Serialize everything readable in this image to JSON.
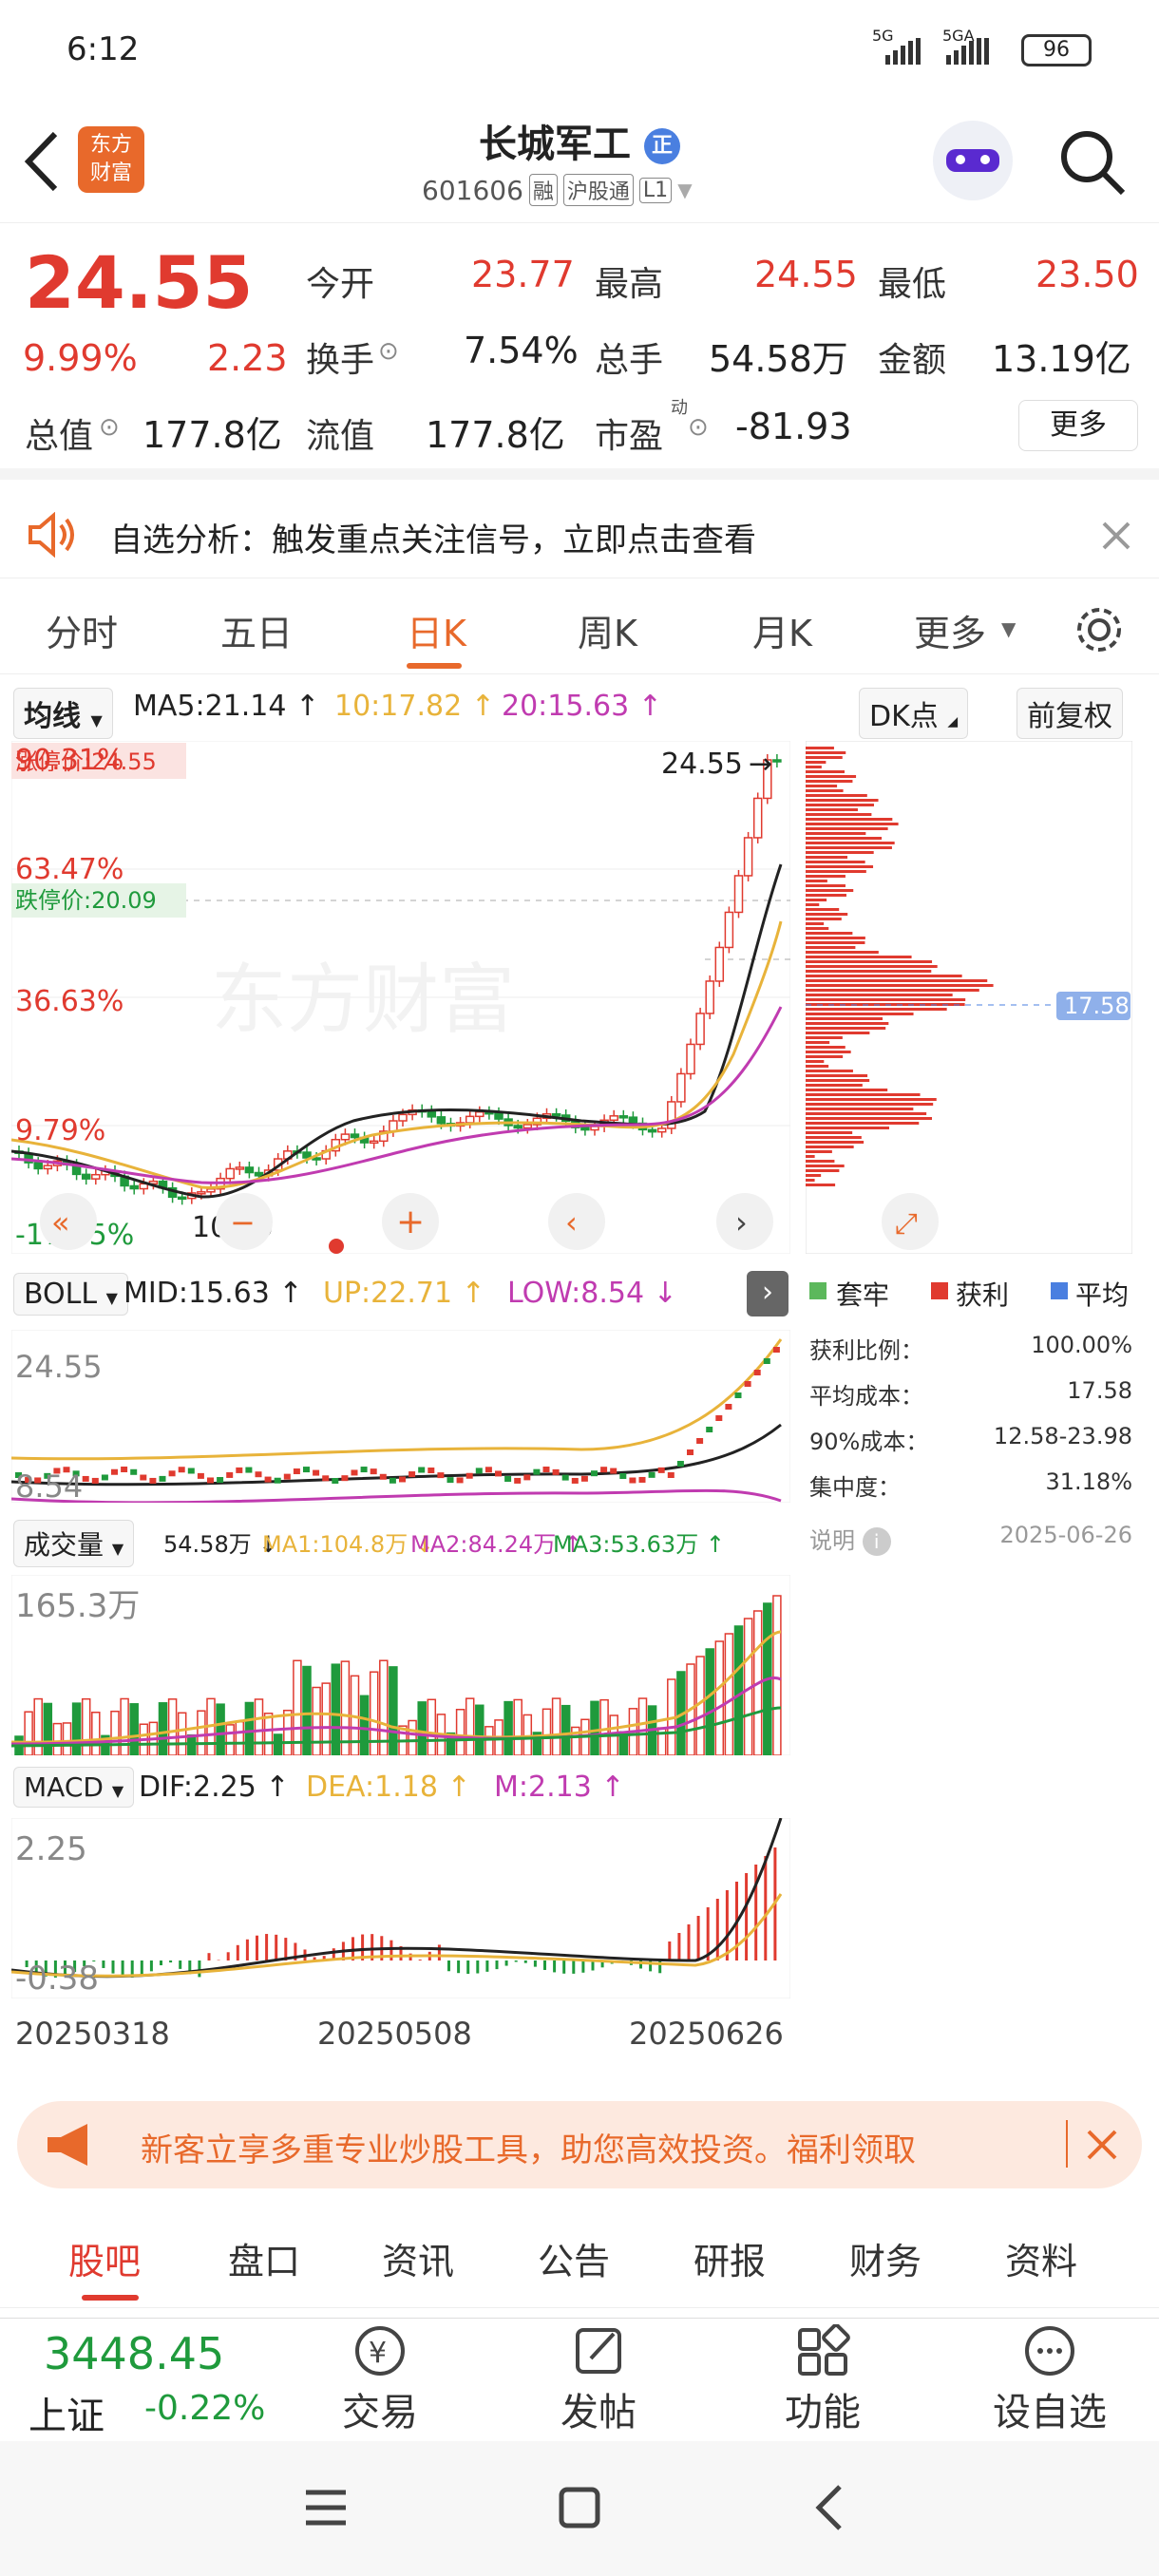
{
  "status_bar": {
    "time": "6:12",
    "net1": "5G",
    "net2": "5GA",
    "battery": "96"
  },
  "header": {
    "logo_text": "东方\n财富",
    "stock_name": "长城军工",
    "badge": "正",
    "stock_code": "601606",
    "tags": [
      "融",
      "沪股通",
      "L1"
    ]
  },
  "quote": {
    "price": "24.55",
    "change_pct": "9.99%",
    "change_amt": "2.23",
    "items": [
      {
        "label": "今开",
        "value": "23.77",
        "color": "red"
      },
      {
        "label": "最高",
        "value": "24.55",
        "color": "red"
      },
      {
        "label": "最低",
        "value": "23.50",
        "color": "red"
      },
      {
        "label": "换手",
        "value": "7.54%",
        "color": "dark"
      },
      {
        "label": "总手",
        "value": "54.58万",
        "color": "dark"
      },
      {
        "label": "金额",
        "value": "13.19亿",
        "color": "dark"
      },
      {
        "label": "总值",
        "value": "177.8亿",
        "color": "dark"
      },
      {
        "label": "流值",
        "value": "177.8亿",
        "color": "dark"
      },
      {
        "label": "市盈",
        "value": "-81.93",
        "color": "dark"
      }
    ],
    "more_button": "更多",
    "pe_superscript": "动"
  },
  "banner": {
    "text": "自选分析：触发重点关注信号，立即点击查看"
  },
  "tabs": [
    "分时",
    "五日",
    "日K",
    "周K",
    "月K",
    "更多"
  ],
  "active_tab": "日K",
  "kline": {
    "indicator_select": "均线",
    "ma5": "MA5:21.14 ↑",
    "ma10": "10:17.82 ↑",
    "ma20": "20:15.63 ↑",
    "dk_select": "DK点",
    "adjust_select": "前复权",
    "y_labels": [
      "90.31%",
      "63.47%",
      "36.63%",
      "9.79%",
      "-17.05%"
    ],
    "limit_up": "涨停价:24.55",
    "limit_down": "跌停价:20.09",
    "last_price": "24.55",
    "low_mark": "10.70",
    "watermark": "东方财富",
    "chip_price": "17.58"
  },
  "boll": {
    "select": "BOLL",
    "mid": "MID:15.63 ↑",
    "up": "UP:22.71 ↑",
    "low": "LOW:8.54 ↓",
    "top_label": "24.55",
    "bottom_label": "8.54"
  },
  "volume": {
    "select": "成交量",
    "v": "54.58万 ↓",
    "ma1": "MA1:104.8万 ↓",
    "ma2": "MA2:84.24万 ↑",
    "ma3": "MA3:53.63万 ↑",
    "top_label": "165.3万"
  },
  "macd": {
    "select": "MACD",
    "dif": "DIF:2.25 ↑",
    "dea": "DEA:1.18 ↑",
    "m": "M:2.13 ↑",
    "top_label": "2.25",
    "bottom_label": "-0.38"
  },
  "dates": [
    "20250318",
    "20250508",
    "20250626"
  ],
  "chips": {
    "legend": [
      "套牢",
      "获利",
      "平均"
    ],
    "rows": [
      {
        "label": "获利比例：",
        "value": "100.00%"
      },
      {
        "label": "平均成本：",
        "value": "17.58"
      },
      {
        "label": "90%成本：",
        "value": "12.58-23.98"
      },
      {
        "label": "集中度：",
        "value": "31.18%"
      }
    ],
    "note_label": "说明",
    "date": "2025-06-26"
  },
  "promo": {
    "text": "新客立享多重专业炒股工具，助您高效投资。福利领取"
  },
  "bottom_tabs": [
    "股吧",
    "盘口",
    "资讯",
    "公告",
    "研报",
    "财务",
    "资料"
  ],
  "footer": {
    "index_value": "3448.45",
    "index_name": "上证",
    "index_change": "-0.22%",
    "actions": [
      "交易",
      "发帖",
      "功能",
      "设自选"
    ]
  },
  "colors": {
    "up": "#e03a2f",
    "down": "#1f9a3c",
    "accent": "#e8692b",
    "ma10": "#e8b33a",
    "ma20": "#c03bb0"
  }
}
